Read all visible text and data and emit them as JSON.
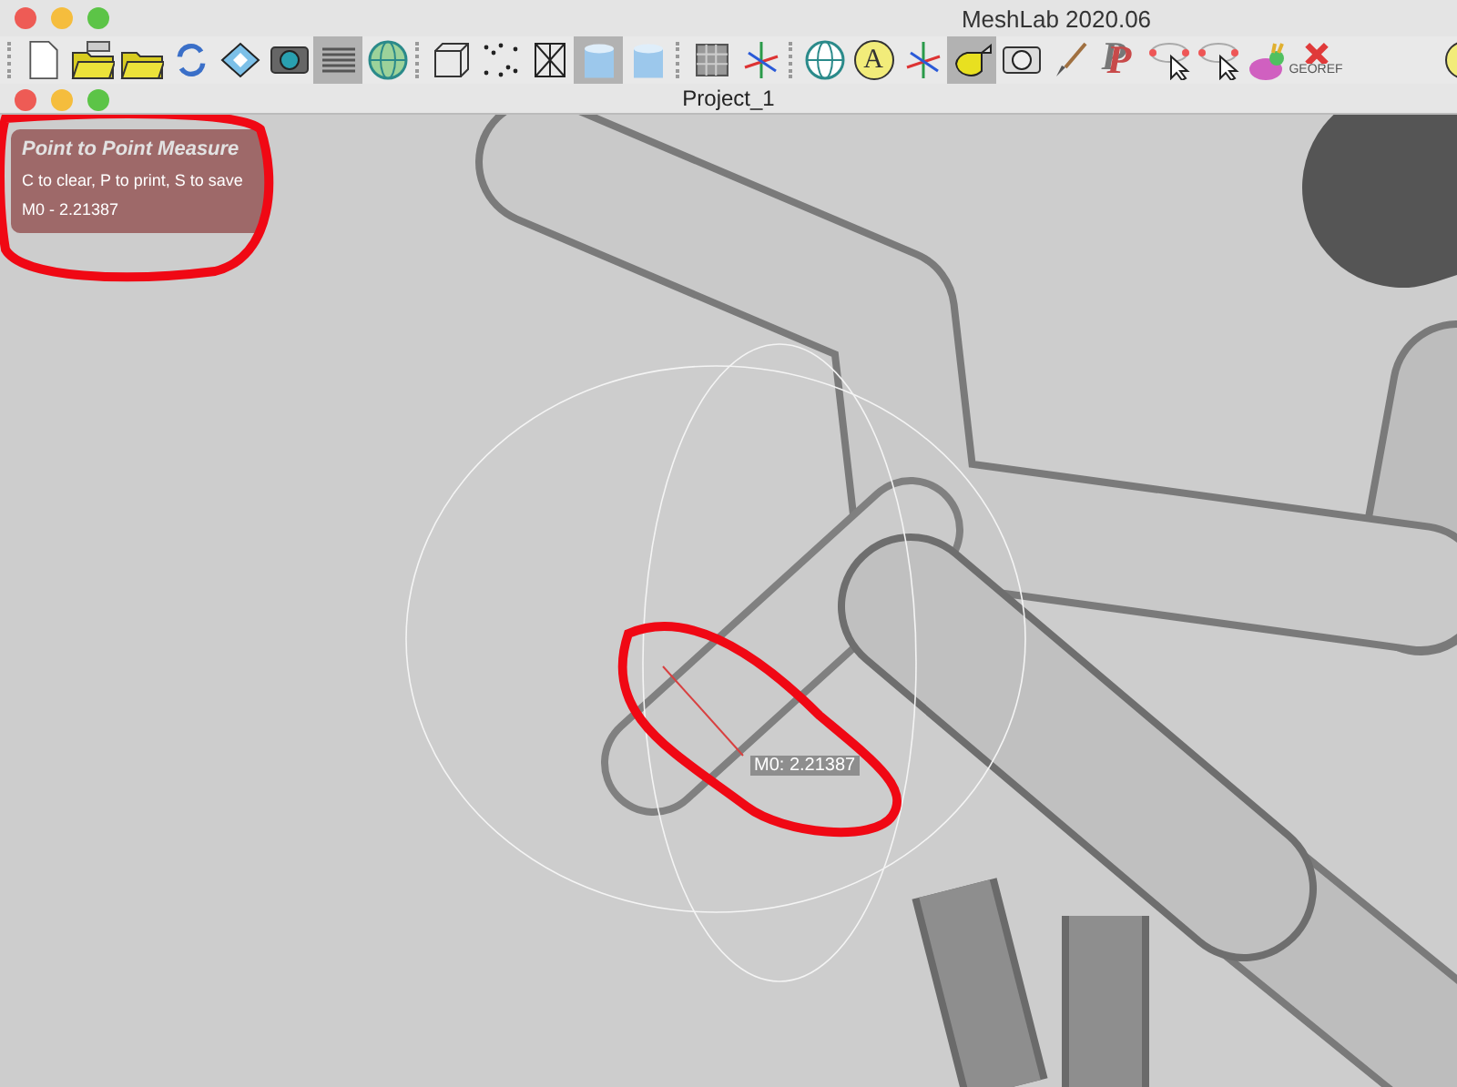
{
  "window": {
    "title": "MeshLab 2020.06"
  },
  "toolbar": [
    {
      "kind": "separator"
    },
    {
      "kind": "new",
      "selected": false
    },
    {
      "kind": "open-stack",
      "selected": false
    },
    {
      "kind": "open",
      "selected": false
    },
    {
      "kind": "reload",
      "selected": false
    },
    {
      "kind": "save",
      "selected": false
    },
    {
      "kind": "snapshot",
      "selected": false
    },
    {
      "kind": "layers",
      "selected": true
    },
    {
      "kind": "globe",
      "selected": false
    },
    {
      "kind": "separator"
    },
    {
      "kind": "box",
      "selected": false
    },
    {
      "kind": "points",
      "selected": false
    },
    {
      "kind": "wire",
      "selected": false
    },
    {
      "kind": "cylinder",
      "selected": true
    },
    {
      "kind": "cylinder",
      "selected": false
    },
    {
      "kind": "separator"
    },
    {
      "kind": "grid",
      "selected": false
    },
    {
      "kind": "axes",
      "selected": false
    },
    {
      "kind": "separator"
    },
    {
      "kind": "trackball",
      "selected": false
    },
    {
      "kind": "letter",
      "selected": false,
      "label": "A"
    },
    {
      "kind": "axis-line",
      "selected": false
    },
    {
      "kind": "measure",
      "selected": true
    },
    {
      "kind": "camera",
      "selected": false
    },
    {
      "kind": "brush",
      "selected": false
    },
    {
      "kind": "letter-p",
      "selected": false,
      "label": "P"
    },
    {
      "kind": "pick",
      "selected": false
    },
    {
      "kind": "select",
      "selected": false
    },
    {
      "kind": "bunny",
      "selected": false
    },
    {
      "kind": "georef",
      "selected": false,
      "label": "GEOREF"
    },
    {
      "kind": "sun",
      "selected": false
    }
  ],
  "document": {
    "title": "Project_1"
  },
  "overlay": {
    "title": "Point to Point Measure",
    "hint": "C to clear, P to print, S to save",
    "measurements": [
      "M0 - 2.21387"
    ]
  },
  "viewport": {
    "labels": [
      "M0: 2.21387"
    ]
  }
}
